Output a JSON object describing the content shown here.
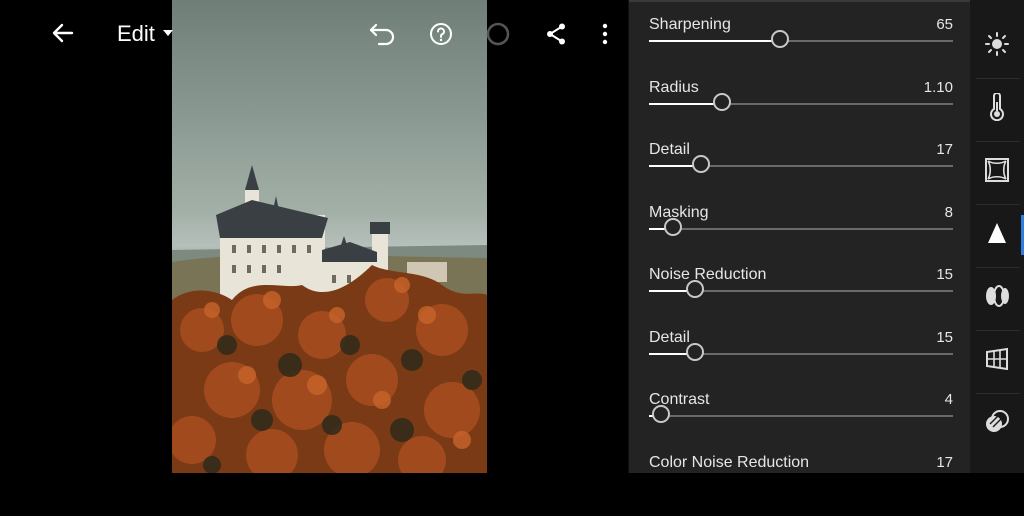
{
  "header": {
    "edit_label": "Edit"
  },
  "panel": {
    "rows": [
      {
        "label": "Sharpening",
        "value": "65",
        "fraction": 0.43
      },
      {
        "label": "Radius",
        "value": "1.10",
        "fraction": 0.24
      },
      {
        "label": "Detail",
        "value": "17",
        "fraction": 0.17
      },
      {
        "label": "Masking",
        "value": "8",
        "fraction": 0.08
      },
      {
        "label": "Noise Reduction",
        "value": "15",
        "fraction": 0.15
      },
      {
        "label": "Detail",
        "value": "15",
        "fraction": 0.15
      },
      {
        "label": "Contrast",
        "value": "4",
        "fraction": 0.04
      },
      {
        "label": "Color Noise Reduction",
        "value": "17",
        "fraction": 0.17
      }
    ]
  },
  "toolbar": {
    "items": [
      "light-icon",
      "color-temperature-icon",
      "effects-vignette-icon",
      "detail-icon",
      "optics-icon",
      "geometry-icon",
      "presets-icon"
    ],
    "active": "detail-icon"
  },
  "colors": {
    "accent": "#2d7ee0",
    "panel_bg": "#232323"
  }
}
